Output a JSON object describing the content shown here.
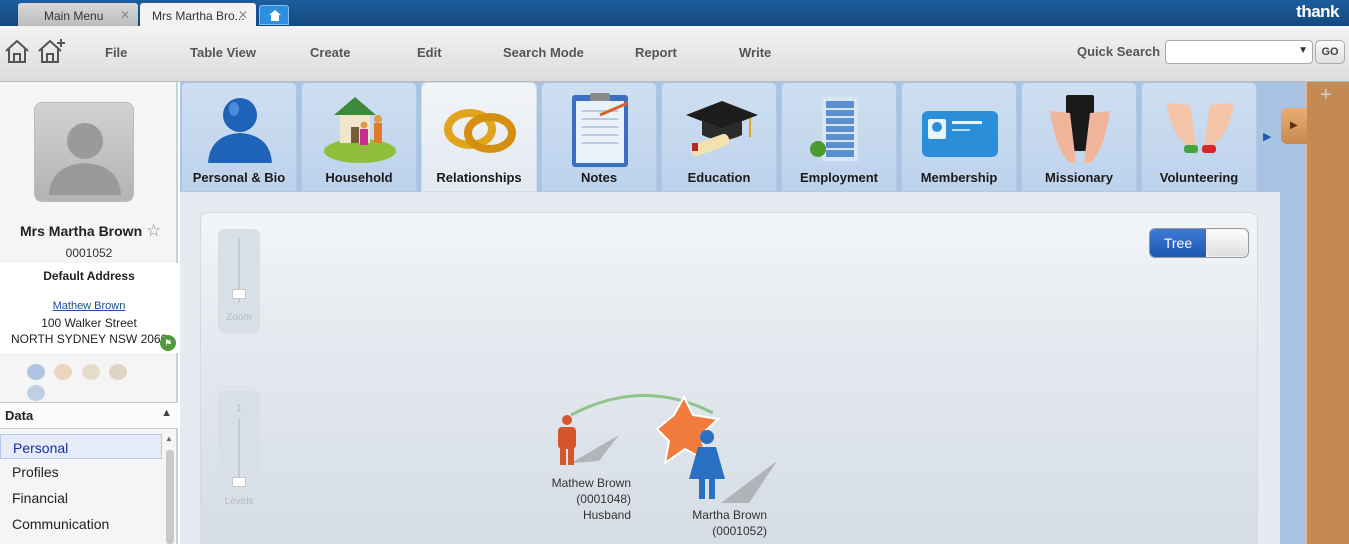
{
  "window_tabs": [
    {
      "label": "Main Menu"
    },
    {
      "label": "Mrs Martha Bro..."
    }
  ],
  "brand": "thank",
  "menu": {
    "items": [
      "File",
      "Table View",
      "Create",
      "Edit",
      "Search Mode",
      "Report",
      "Write"
    ],
    "quick_search_label": "Quick Search",
    "quick_search_value": "",
    "go_label": "GO"
  },
  "profile": {
    "name": "Mrs Martha Brown",
    "id": "0001052",
    "address_title": "Default Address",
    "address_contact": "Mathew Brown",
    "address_line1": "100 Walker Street",
    "address_line2": "NORTH SYDNEY NSW 2060"
  },
  "data_panel": {
    "title": "Data",
    "items": [
      "Personal",
      "Profiles",
      "Financial",
      "Communication"
    ],
    "active": "Personal"
  },
  "categories": [
    {
      "label": "Personal & Bio",
      "icon": "person-bust-icon"
    },
    {
      "label": "Household",
      "icon": "household-icon"
    },
    {
      "label": "Relationships",
      "icon": "rings-icon"
    },
    {
      "label": "Notes",
      "icon": "notepad-icon"
    },
    {
      "label": "Education",
      "icon": "graduation-cap-icon"
    },
    {
      "label": "Employment",
      "icon": "office-building-icon"
    },
    {
      "label": "Membership",
      "icon": "membership-card-icon"
    },
    {
      "label": "Missionary",
      "icon": "bible-hands-icon"
    },
    {
      "label": "Volunteering",
      "icon": "helping-hands-icon"
    }
  ],
  "active_category": "Relationships",
  "tree_view": {
    "toggle_label": "Tree",
    "zoom_label": "Zoom",
    "levels_label": "Levels",
    "levels_value": "1",
    "nodes": [
      {
        "name": "Mathew Brown",
        "id": "(0001048)",
        "relation": "Husband",
        "gender": "male"
      },
      {
        "name": "Martha Brown",
        "id": "(0001052)",
        "relation": "",
        "gender": "female"
      }
    ]
  },
  "colors": {
    "title_bar": "#14497f",
    "male_figure": "#d5562d",
    "female_figure": "#2a6fc1",
    "star": "#f07b3c",
    "relation_arc": "#8fc48d",
    "corkboard": "#c48a54"
  }
}
